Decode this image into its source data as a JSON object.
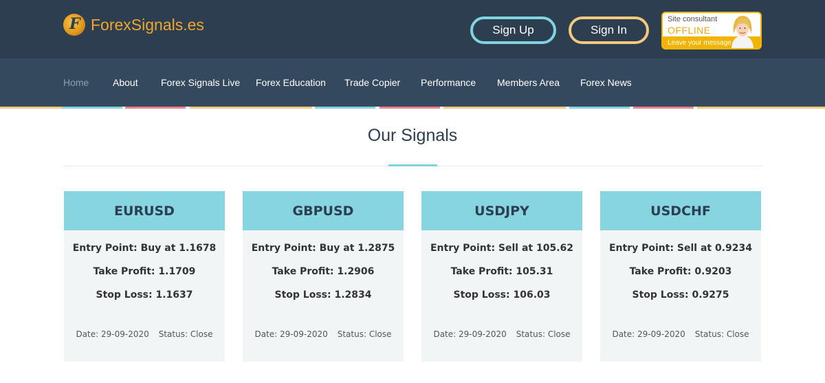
{
  "header": {
    "logo_letter": "F",
    "logo_text": "ForexSignals.es",
    "signup_label": "Sign Up",
    "signin_label": "Sign In",
    "consultant": {
      "title": "Site consultant",
      "status": "OFFLINE",
      "message": "Leave your message"
    }
  },
  "nav": {
    "items": [
      {
        "label": "Home"
      },
      {
        "label": "About"
      },
      {
        "label": "Forex Signals Live"
      },
      {
        "label": "Forex Education"
      },
      {
        "label": "Trade Copier"
      },
      {
        "label": "Performance"
      },
      {
        "label": "Members Area"
      },
      {
        "label": "Forex News"
      }
    ]
  },
  "colors": {
    "header_bg": "#2c3e50",
    "nav_bg": "#34495e",
    "accent_teal": "#80d3df",
    "accent_yellow": "#f5c97b",
    "accent_pink": "#f07f8f",
    "logo_orange": "#f0a72c"
  },
  "main": {
    "title": "Our Signals",
    "cards": [
      {
        "pair": "EURUSD",
        "entry": "Entry Point: Buy at 1.1678",
        "take_profit": "Take Profit: 1.1709",
        "stop_loss": "Stop Loss: 1.1637",
        "date": "Date: 29-09-2020",
        "status": "Status: Close"
      },
      {
        "pair": "GBPUSD",
        "entry": "Entry Point: Buy at 1.2875",
        "take_profit": "Take Profit: 1.2906",
        "stop_loss": "Stop Loss: 1.2834",
        "date": "Date: 29-09-2020",
        "status": "Status: Close"
      },
      {
        "pair": "USDJPY",
        "entry": "Entry Point: Sell at 105.62",
        "take_profit": "Take Profit: 105.31",
        "stop_loss": "Stop Loss: 106.03",
        "date": "Date: 29-09-2020",
        "status": "Status: Close"
      },
      {
        "pair": "USDCHF",
        "entry": "Entry Point: Sell at 0.9234",
        "take_profit": "Take Profit: 0.9203",
        "stop_loss": "Stop Loss: 0.9275",
        "date": "Date: 29-09-2020",
        "status": "Status: Close"
      }
    ]
  }
}
